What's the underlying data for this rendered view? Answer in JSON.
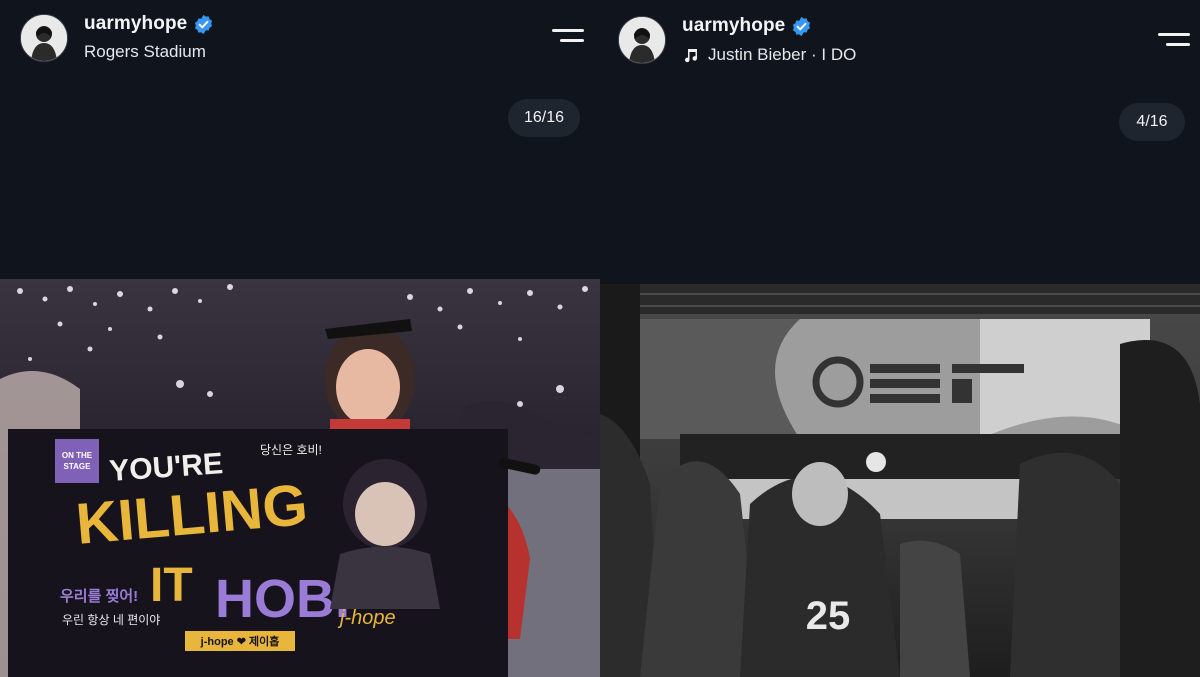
{
  "left": {
    "username": "uarmyhope",
    "location": "Rogers Stadium",
    "counter": "16/16",
    "banner": {
      "line1": "YOU'RE",
      "line2": "KILLING",
      "line3": "IT",
      "line4": "HOBI",
      "badge": "ON THE STAGE",
      "signature": "j-hope",
      "korean_top": "당신은 호비!",
      "korean_mid": "우리를 찢어!",
      "korean_bottom": "우린 항상 네 편이야",
      "footer": "j-hope ❤ 제이홉"
    }
  },
  "right": {
    "username": "uarmyhope",
    "music": "Justin Bieber · I DO",
    "counter": "4/16",
    "jersey_number": "25"
  },
  "colors": {
    "background": "#10151d",
    "verified": "#3897f0",
    "counter_bg": "#1f252e",
    "banner_yellow": "#e8b63a",
    "banner_purple": "#9a7cd6"
  }
}
